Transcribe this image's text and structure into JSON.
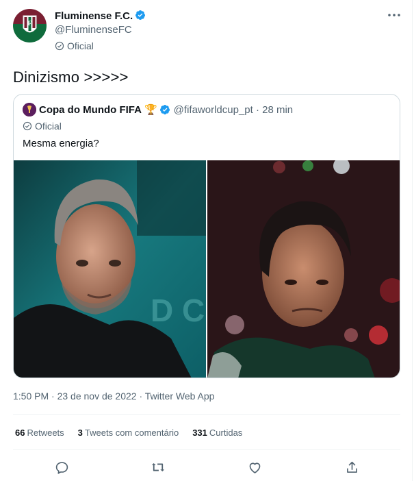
{
  "author": {
    "name": "Fluminense F.C.",
    "handle": "@FluminenseFC",
    "label": "Oficial",
    "avatar_icon": "fluminense-crest",
    "colors": {
      "green": "#0f6b3c",
      "maroon": "#7a1f32"
    }
  },
  "tweet": {
    "text": "Dinizismo >>>>>"
  },
  "quote": {
    "name": "Copa do Mundo FIFA",
    "emoji": "🏆",
    "handle_time": "@fifaworldcup_pt · 28 min",
    "label": "Oficial",
    "text": "Mesma energia?",
    "images": [
      "photo-man-grey-hair",
      "photo-man-dark-hair"
    ]
  },
  "meta": {
    "timestamp": "1:50 PM · 23 de nov de 2022 · Twitter Web App"
  },
  "stats": {
    "retweets_count": "66",
    "retweets_label": "Retweets",
    "quotes_count": "3",
    "quotes_label": "Tweets com comentário",
    "likes_count": "331",
    "likes_label": "Curtidas"
  },
  "accent": "#1d9bf0"
}
